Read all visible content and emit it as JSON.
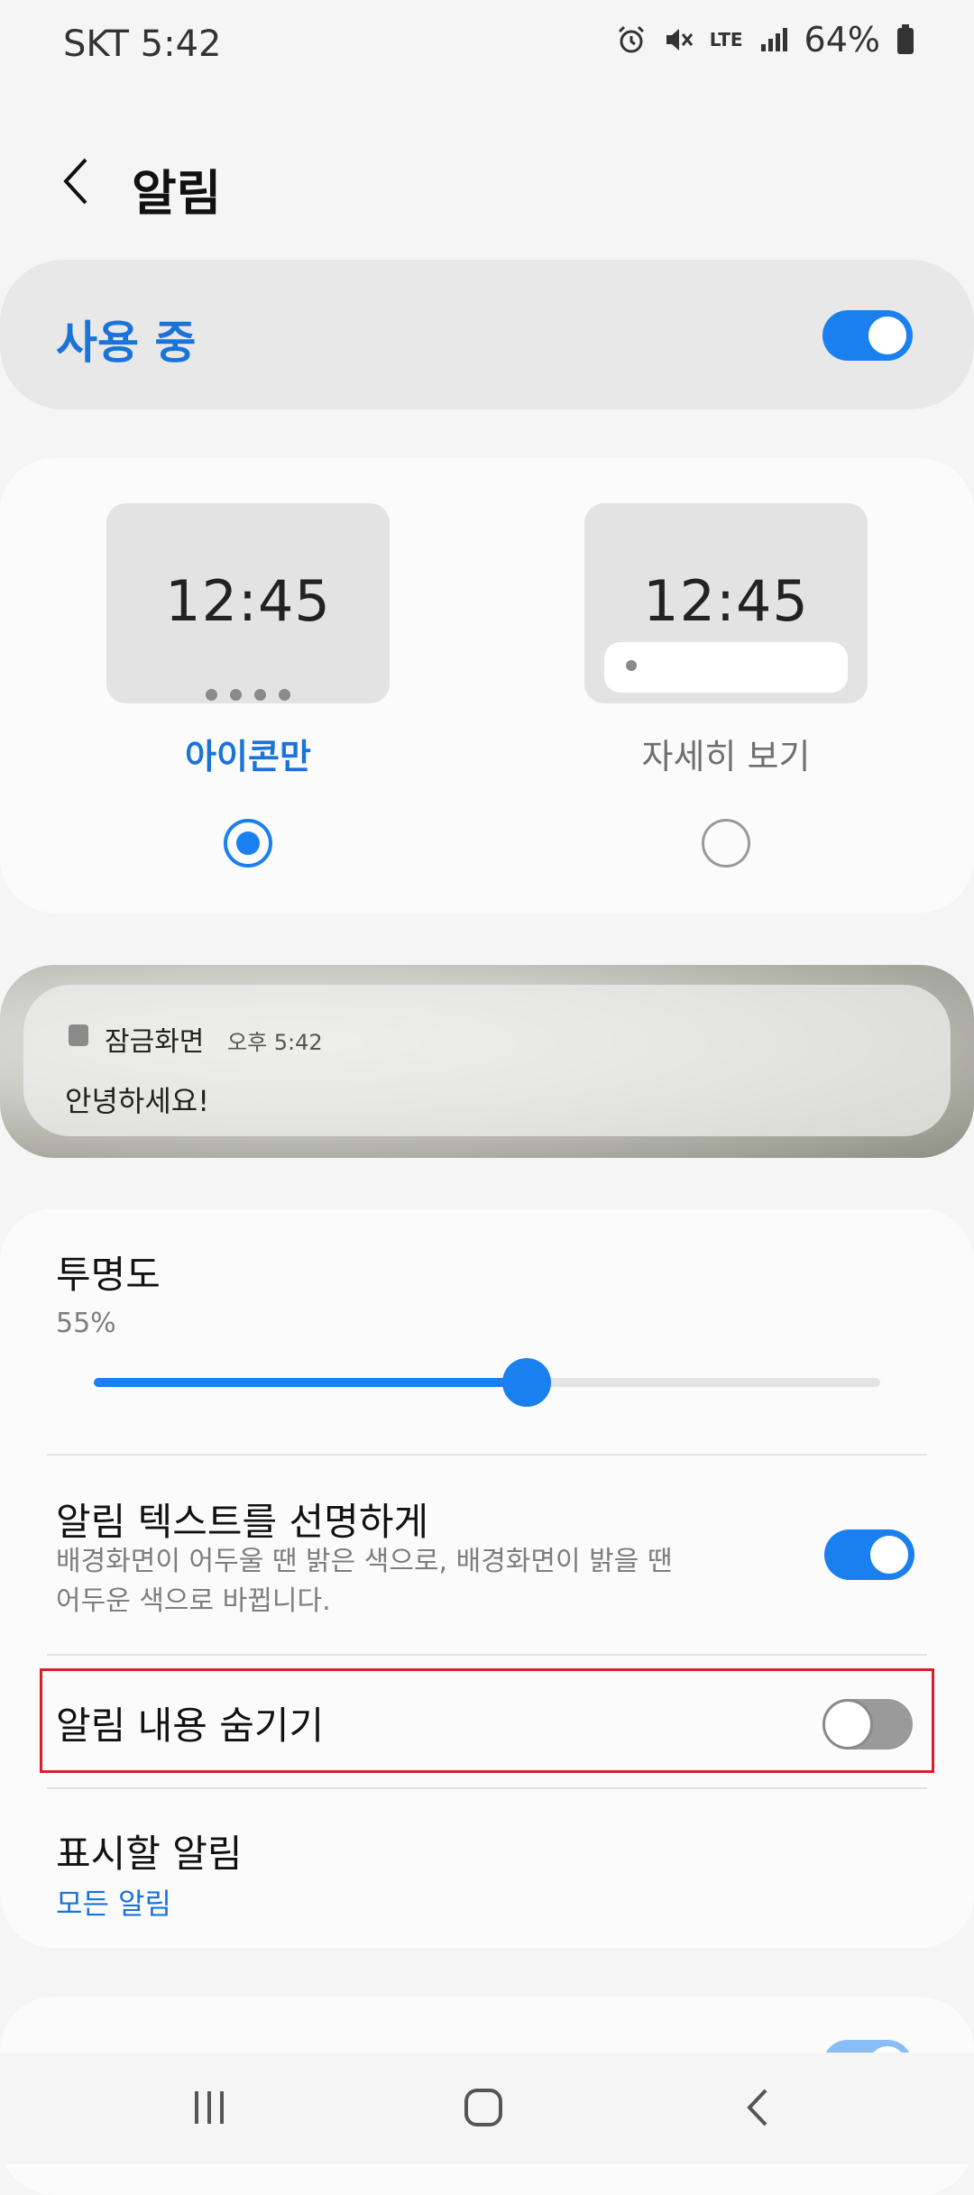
{
  "status_bar": {
    "carrier": "SKT",
    "time": "5:42",
    "network": "LTE",
    "battery": "64%",
    "icons": [
      "alarm-icon",
      "mute-icon",
      "lte-icon",
      "signal-icon",
      "battery-icon"
    ]
  },
  "header": {
    "title": "알림",
    "back_icon": "back-arrow-icon"
  },
  "master_switch": {
    "label": "사용 중",
    "enabled": true
  },
  "notification_style": {
    "options": [
      {
        "label": "아이콘만",
        "preview_time": "12:45",
        "selected": true
      },
      {
        "label": "자세히 보기",
        "preview_time": "12:45",
        "selected": false
      }
    ]
  },
  "lockscreen_preview": {
    "app": "잠금화면",
    "time": "오후 5:42",
    "text": "안녕하세요!"
  },
  "settings": {
    "transparency": {
      "title": "투명도",
      "value_text": "55%",
      "value": 0.55
    },
    "invert_text": {
      "title": "알림 텍스트를 선명하게",
      "subtitle_line1": "배경화면이 어두울 땐 밝은 색으로, 배경화면이 밝을 땐",
      "subtitle_line2": "어두운 색으로 바뀝니다.",
      "enabled": true
    },
    "hide_content": {
      "title": "알림 내용 숨기기",
      "enabled": false
    },
    "notifications_to_show": {
      "title": "표시할 알림",
      "value": "모든 알림"
    }
  },
  "nav_bar": {
    "icons": [
      "recent-apps-icon",
      "home-icon",
      "back-icon"
    ]
  },
  "colors": {
    "accent": "#1a80f0",
    "highlight_box": "#d8202a"
  }
}
